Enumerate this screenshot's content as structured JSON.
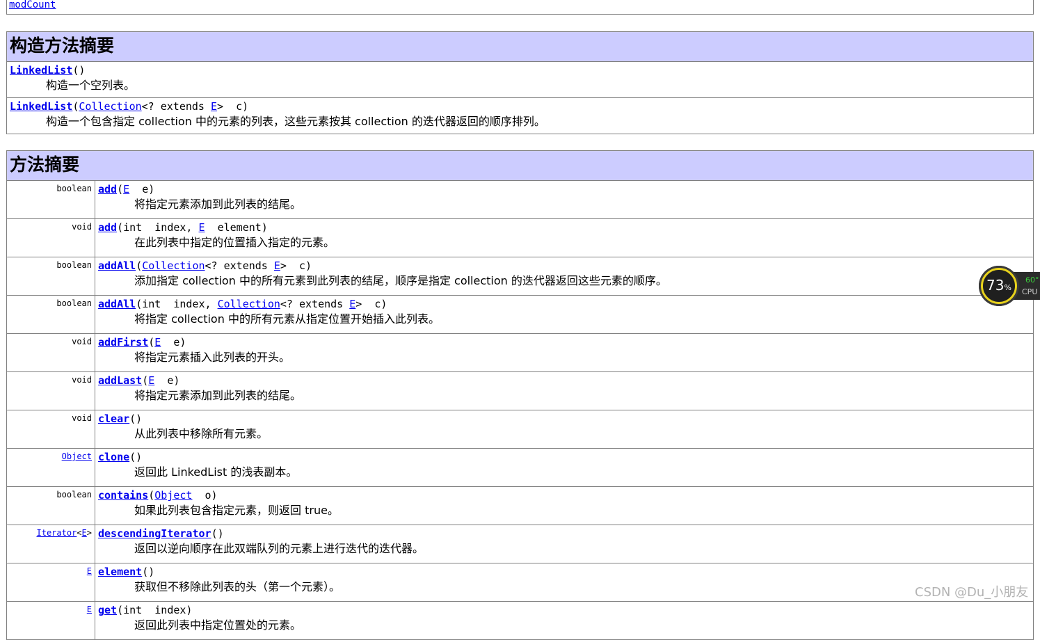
{
  "top_table": {
    "link": "modCount"
  },
  "constructor_summary": {
    "title": "构造方法摘要",
    "rows": [
      {
        "sig_prefix": "",
        "name": "LinkedList",
        "sig_parts": [
          "()"
        ],
        "desc": "构造一个空列表。"
      },
      {
        "name": "LinkedList",
        "sig_parts": [
          "(",
          "Collection",
          "<? extends ",
          "E",
          ">  c)"
        ],
        "desc": "构造一个包含指定 collection 中的元素的列表，这些元素按其 collection 的迭代器返回的顺序排列。"
      }
    ]
  },
  "method_summary": {
    "title": "方法摘要",
    "rows": [
      {
        "ret": "boolean",
        "name": "add",
        "params": "(E  e)",
        "desc": "将指定元素添加到此列表的结尾。"
      },
      {
        "ret": "void",
        "name": "add",
        "params": "(int  index, E  element)",
        "desc": "在此列表中指定的位置插入指定的元素。"
      },
      {
        "ret": "boolean",
        "name": "addAll",
        "params": "(Collection<? extends E>  c)",
        "desc": "添加指定 collection 中的所有元素到此列表的结尾，顺序是指定 collection 的迭代器返回这些元素的顺序。"
      },
      {
        "ret": "boolean",
        "name": "addAll",
        "params": "(int  index, Collection<? extends E>  c)",
        "desc": "将指定 collection 中的所有元素从指定位置开始插入此列表。"
      },
      {
        "ret": "void",
        "name": "addFirst",
        "params": "(E  e)",
        "desc": "将指定元素插入此列表的开头。"
      },
      {
        "ret": "void",
        "name": "addLast",
        "params": "(E  e)",
        "desc": "将指定元素添加到此列表的结尾。"
      },
      {
        "ret": "void",
        "name": "clear",
        "params": "()",
        "desc": "从此列表中移除所有元素。"
      },
      {
        "ret": "Object",
        "name": "clone",
        "params": "()",
        "desc": "返回此 LinkedList 的浅表副本。"
      },
      {
        "ret": "boolean",
        "name": "contains",
        "params": "(Object  o)",
        "desc": "如果此列表包含指定元素，则返回 true。"
      },
      {
        "ret": "Iterator<E>",
        "name": "descendingIterator",
        "params": "()",
        "desc": "返回以逆向顺序在此双端队列的元素上进行迭代的迭代器。"
      },
      {
        "ret": "E",
        "name": "element",
        "params": "()",
        "desc": "获取但不移除此列表的头（第一个元素）。"
      },
      {
        "ret": "E",
        "name": "get",
        "params": "(int  index)",
        "desc": "返回此列表中指定位置处的元素。"
      }
    ]
  },
  "cpu_widget": {
    "percent": "73",
    "percent_sign": "%",
    "temp": "60°",
    "label": "CPU",
    "ring_color": "#e8d21c"
  },
  "watermark": "CSDN @Du_小朋友"
}
